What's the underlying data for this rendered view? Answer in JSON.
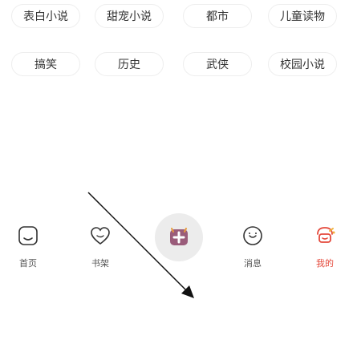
{
  "tags": {
    "row1": [
      "表白小说",
      "甜宠小说",
      "都市",
      "儿童读物"
    ],
    "row2": [
      "搞笑",
      "历史",
      "武侠",
      "校园小说"
    ]
  },
  "bottom_nav": {
    "items": [
      {
        "label": "首页",
        "icon": "home-icon",
        "active": false
      },
      {
        "label": "书架",
        "icon": "heart-icon",
        "active": false
      },
      {
        "label": "",
        "icon": "add-post-icon",
        "active": false
      },
      {
        "label": "消息",
        "icon": "message-icon",
        "active": false
      },
      {
        "label": "我的",
        "icon": "user-icon",
        "active": true
      }
    ]
  },
  "colors": {
    "accent": "#e4483a",
    "text": "#333333"
  }
}
